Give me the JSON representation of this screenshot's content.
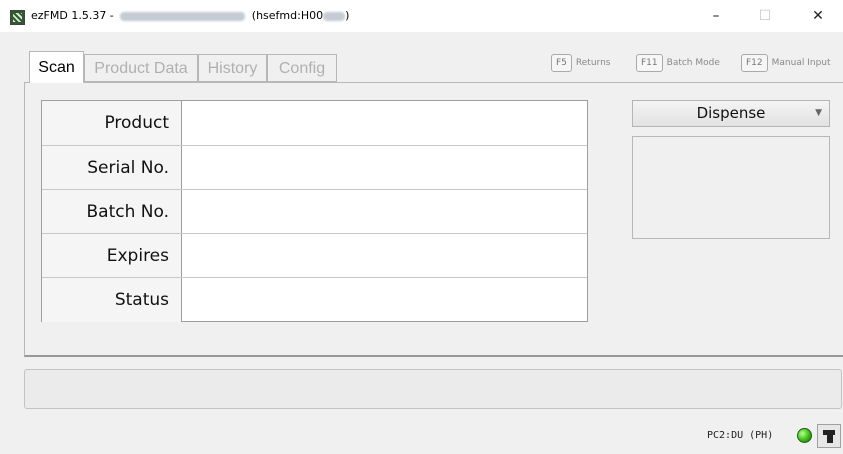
{
  "window": {
    "title_prefix": "ezFMD 1.5.37 -",
    "title_suffix": "(hsefmd:H00",
    "title_suffix_close": ")",
    "minimize": "–",
    "maximize": "☐",
    "close": "✕"
  },
  "tabs": [
    {
      "label": "Scan",
      "active": true
    },
    {
      "label": "Product Data",
      "active": false
    },
    {
      "label": "History",
      "active": false
    },
    {
      "label": "Config",
      "active": false
    }
  ],
  "function_keys": [
    {
      "key": "F5",
      "label": "Returns"
    },
    {
      "key": "F11",
      "label": "Batch Mode"
    },
    {
      "key": "F12",
      "label": "Manual Input"
    }
  ],
  "scan_fields": [
    {
      "label": "Product",
      "value": ""
    },
    {
      "label": "Serial No.",
      "value": ""
    },
    {
      "label": "Batch No.",
      "value": ""
    },
    {
      "label": "Expires",
      "value": ""
    },
    {
      "label": "Status",
      "value": ""
    }
  ],
  "mode_select": {
    "value": "Dispense",
    "caret": "▼"
  },
  "status_message": "",
  "connection": {
    "label": "PC2:DU (PH)",
    "status_color": "#2fb30f"
  },
  "icons": {
    "app": "app-icon",
    "scanner": "barcode-scanner-icon",
    "led": "status-led-icon"
  }
}
